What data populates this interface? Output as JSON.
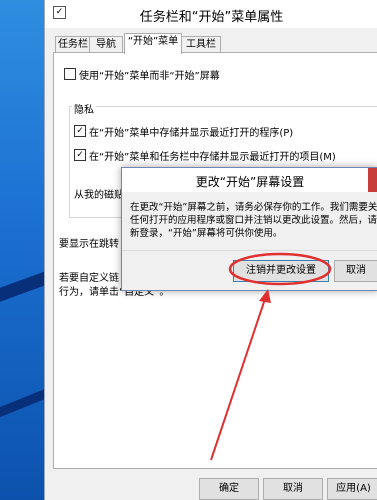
{
  "window": {
    "title": "任务栏和“开始”菜单属性",
    "title_icon": "checkbox-icon"
  },
  "tabs": [
    {
      "label": "任务栏"
    },
    {
      "label": "导航"
    },
    {
      "label": "“开始”菜单",
      "active": true
    },
    {
      "label": "工具栏"
    }
  ],
  "start_menu": {
    "use_start_menu_label": "使用“开始”菜单而非“开始”屏幕",
    "use_start_menu_checked": false
  },
  "privacy": {
    "group_label": "隐私",
    "item1_label": "在“开始”菜单中存储并显示最近打开的程序(P)",
    "item1_checked": true,
    "item2_label": "在“开始”菜单和任务栏中存储并显示最近打开的项目(M)",
    "item2_checked": true,
    "jump_list_label": "从我的磁贴"
  },
  "jump_list_text": "要显示在跳转",
  "customize_text_line1": "若要自定义链",
  "customize_text_line2": "行为，请单击“自定义”。",
  "footer": {
    "ok_label": "确定",
    "cancel_label": "取消",
    "apply_label": "应用(A)"
  },
  "dialog": {
    "title": "更改“开始”屏幕设置",
    "body_line1": "在更改“开始”屏幕之前，请务必保存你的工作。我们需要关闭",
    "body_line2": "任何打开的应用程序或窗口并注销以更改此设置。然后，请重",
    "body_line3": "新登录，“开始”屏幕将可供你使用。",
    "signout_button": "注销并更改设置",
    "cancel_button": "取消"
  },
  "colors": {
    "annotation": "#e03030",
    "desktop": "#1b6fd1"
  }
}
